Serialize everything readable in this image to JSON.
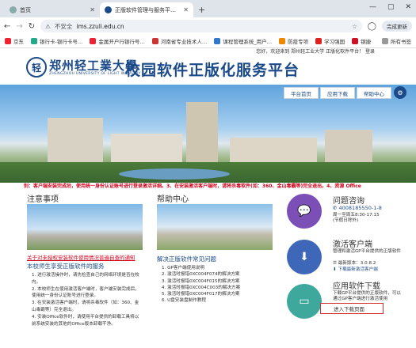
{
  "browser": {
    "tabs": [
      {
        "title": "首页"
      },
      {
        "title": "正版软件管理与服务平台(郑州轻工业大学)"
      }
    ],
    "address": {
      "warning": "不安全",
      "url": "ims.zzuli.edu.cn"
    },
    "done_label": "完成更新",
    "bookmarks": [
      "京东",
      "银行卡-银行卡号…",
      "金属开户行银行号…",
      "河南省专业技术人…",
      "课程管理系统_用户…",
      "防疫专项",
      "学习强国",
      "钢捷"
    ],
    "bookmarks_right": "所有书签"
  },
  "site": {
    "welcome": "您好，欢迎来到 郑州轻工业大学 正版化软件平台！ 登录",
    "uni_name": "郑州轻工業大學",
    "uni_en": "ZHENGZHOU UNIVERSITY OF LIGHT INDUSTRY",
    "title": "校园软件正版化服务平台",
    "nav": [
      "平台首页",
      "应用下载",
      "帮助中心"
    ],
    "marquee": "别：客户端安装完成后，使用统一身份认证账号进行登录激活详细。3、在安装激活客户端时，请将杀毒软件(如：360、金山毒霸等)完全退出。4、资源 Office"
  },
  "notice": {
    "title": "注意事项",
    "link": "关于对未授权安装软件使用情况普遍自查的通知",
    "sub": "本校师生享受正版软件的服务",
    "items": [
      "1. 进行激活操作时，请先检查自己的网络环境是否在校内。",
      "2. 本校师生在使用激活客户端时，客户端安装完成后，使用统一身份认证账号进行登录。",
      "3. 在安装激活客户端时，请将杀毒软件（如：360、金山毒霸等）完全退出。",
      "4. 安装Office软件时，请使用平台提供的卸载工具将以前系统安装的其他的Office版本卸载干净。"
    ]
  },
  "help": {
    "title": "帮助中心",
    "sub": "解决正版软件常见问题",
    "items": [
      "1. GP客户端使用说明",
      "2. 激活时报错0XC004F074的解决方案",
      "3. 激活时报错0XC004F015的解决方案",
      "4. 激活时报错0XC004C003的解决方案",
      "5. 激活时报错0XC004F017的解决方案",
      "6. U盘安装盘制作教程"
    ]
  },
  "consult": {
    "title": "问题咨询",
    "phone": "4008185550-1-8",
    "hours": "周一至周五8:30-17:15",
    "hours2": "(节假日除外)"
  },
  "activate": {
    "title": "激活客户端",
    "desc": "管理和激活GP平台提供的正版软件",
    "version": "最新版本：3.0.8.2",
    "download_label": "下载最新激活客户端"
  },
  "apps": {
    "title": "应用软件下载",
    "desc": "下载GP平台提供的正版软件，可以通过GP客户端进行激活使用",
    "button": "进入下载页面"
  },
  "colors": {
    "brand": "#1b4a8a",
    "alert": "#d0021b",
    "purple": "#7b4fb6",
    "blue": "#3f67b9",
    "teal": "#3fa89c"
  }
}
